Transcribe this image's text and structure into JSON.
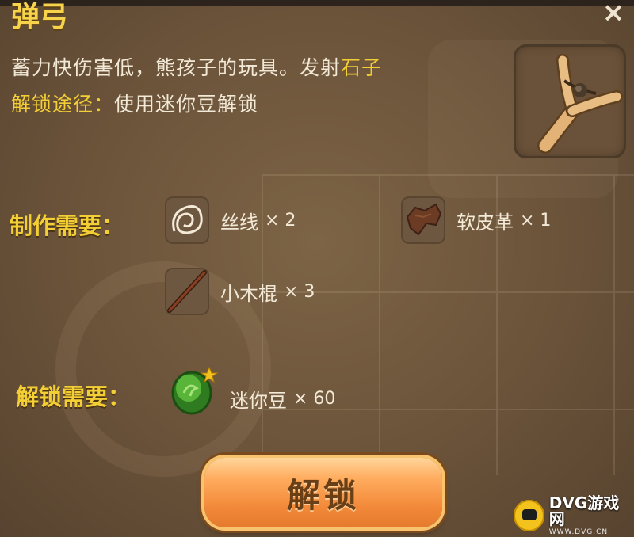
{
  "header": {
    "title_fragment": "弹弓",
    "close_symbol": "×"
  },
  "item": {
    "description_prefix": "蓄力快伤害低，熊孩子的玩具。发射",
    "ammo": "石子",
    "unlock_path_label": "解锁途径：",
    "unlock_path_value": "使用迷你豆解锁",
    "icon": "slingshot-icon"
  },
  "crafting": {
    "label": "制作需要：",
    "materials": [
      {
        "name": "丝线",
        "count": "× 2",
        "icon": "thread-icon"
      },
      {
        "name": "软皮革",
        "count": "× 1",
        "icon": "leather-icon"
      },
      {
        "name": "小木棍",
        "count": "× 3",
        "icon": "stick-icon"
      }
    ]
  },
  "unlock": {
    "label": "解锁需要：",
    "currency_name": "迷你豆",
    "currency_count": "× 60",
    "currency_icon": "mini-bean-icon",
    "button_label": "解锁"
  },
  "watermark": {
    "main": "DVG游戏网",
    "sub": "WWW.DVG.CN"
  },
  "colors": {
    "panel": "#6b533a",
    "highlight": "#f3cf35",
    "text": "#f2e9d7",
    "button": "#f28a3a"
  }
}
